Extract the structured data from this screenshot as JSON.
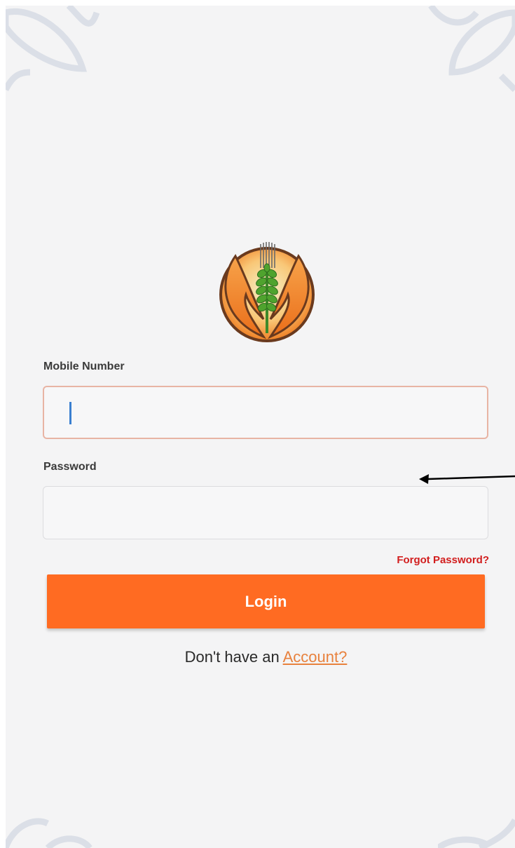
{
  "login_form": {
    "mobile_label": "Mobile Number",
    "mobile_value": "",
    "password_label": "Password",
    "password_value": "",
    "forgot_password": "Forgot Password?",
    "login_button": "Login",
    "signup_prompt": "Don't have an ",
    "signup_link": "Account?"
  },
  "colors": {
    "background": "#f4f4f5",
    "accent": "#ff6b22",
    "forgot_link": "#d21e1e",
    "account_link": "#e8813d",
    "caret": "#3a7fd0"
  },
  "icons": {
    "logo": "wheat-logo-icon",
    "arrow": "arrow-left-icon",
    "decoration": "leaf-decoration-icon"
  }
}
